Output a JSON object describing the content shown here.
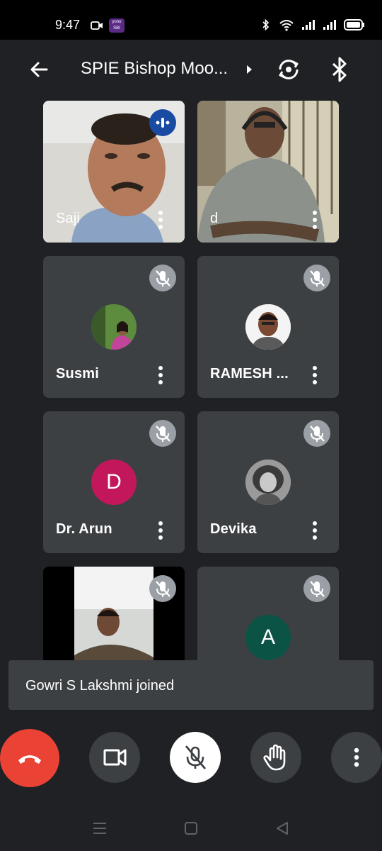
{
  "status_bar": {
    "time": "9:47",
    "app_badge": "yono SBI"
  },
  "header": {
    "title": "SPIE Bishop Moo..."
  },
  "participants": [
    {
      "name": "Saji"
    },
    {
      "name": "d"
    },
    {
      "name": "Susmi"
    },
    {
      "name": "RAMESH ..."
    },
    {
      "name": "Dr. Arun",
      "initial": "D",
      "avatar_color": "#c2185b"
    },
    {
      "name": "Devika"
    },
    {
      "name": ""
    },
    {
      "name": "",
      "initial": "A",
      "avatar_color": "#0b5345"
    }
  ],
  "toast": {
    "message": "Gowri S Lakshmi joined"
  },
  "colors": {
    "end_call": "#ea4335",
    "tile_bg": "#3c4043",
    "speaking": "#1a4ba3"
  }
}
